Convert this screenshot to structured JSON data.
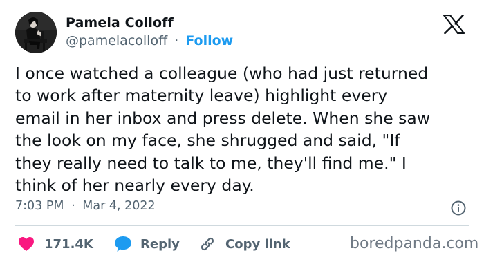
{
  "author": {
    "name": "Pamela Colloff",
    "handle": "@pamelacolloff",
    "separator": "·",
    "follow_label": "Follow"
  },
  "tweet": {
    "lines": [
      "I once watched a colleague (who had just returned",
      "to work after maternity leave) highlight every",
      "email in her inbox and press delete. When she saw",
      "the look on my face, she shrugged and said, \"If",
      "they really need to talk to me, they'll find me.\" I",
      "think of her nearly every day."
    ]
  },
  "meta": {
    "time": "7:03 PM",
    "separator": "·",
    "date": "Mar 4, 2022"
  },
  "actions": {
    "likes": "171.4K",
    "reply_label": "Reply",
    "copy_label": "Copy link"
  },
  "icons": {
    "platform": "x-logo-icon",
    "info": "info-icon",
    "like": "heart-icon",
    "reply": "speech-bubble-icon",
    "copy": "link-icon"
  },
  "colors": {
    "text": "#0f1419",
    "secondary": "#536471",
    "accent": "#1d9bf0",
    "like": "#f91880",
    "divider": "#cfd9de"
  },
  "watermark": "boredpanda.com"
}
